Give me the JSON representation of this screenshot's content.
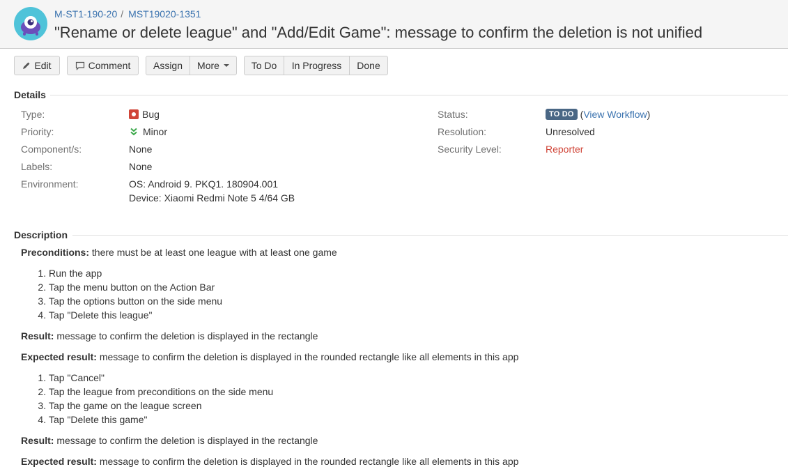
{
  "header": {
    "breadcrumb": [
      {
        "label": "M-ST1-190-20"
      },
      {
        "label": "MST19020-1351"
      }
    ],
    "breadcrumb_separator": "/",
    "summary": "\"Rename or delete league\" and \"Add/Edit Game\": message to confirm the deletion is not unified",
    "avatar_icon": "project-avatar-monster-icon"
  },
  "toolbar": {
    "edit_label": "Edit",
    "comment_label": "Comment",
    "assign_label": "Assign",
    "more_label": "More",
    "todo_label": "To Do",
    "in_progress_label": "In Progress",
    "done_label": "Done"
  },
  "details": {
    "heading": "Details",
    "left": [
      {
        "label": "Type:",
        "value": "Bug",
        "icon": "bug-icon"
      },
      {
        "label": "Priority:",
        "value": "Minor",
        "icon": "priority-minor-icon"
      },
      {
        "label": "Component/s:",
        "value": "None"
      },
      {
        "label": "Labels:",
        "value": "None"
      },
      {
        "label": "Environment:",
        "value": "OS: Android 9. PKQ1. 180904.001",
        "value2": "Device: Xiaomi Redmi Note 5 4/64 GB"
      }
    ],
    "right": {
      "status_label": "Status:",
      "status_value": "TO DO",
      "status_link_open": "(",
      "status_link": "View Workflow",
      "status_link_close": ")",
      "resolution_label": "Resolution:",
      "resolution_value": "Unresolved",
      "security_label": "Security Level:",
      "security_value": "Reporter"
    }
  },
  "description": {
    "heading": "Description",
    "preconditions_label": "Preconditions:",
    "preconditions_text": " there must be at least one league with at least one game",
    "steps_1": [
      "Run the app",
      "Tap the menu button on the Action Bar",
      "Tap the options button on the side menu",
      "Tap \"Delete this league\""
    ],
    "result_label": "Result:",
    "result_text": " message to confirm the deletion is displayed in the rectangle",
    "expected_label": "Expected result:",
    "expected_text": " message to confirm the deletion is displayed in the rounded rectangle like all elements in this app",
    "steps_2": [
      "Tap \"Cancel\"",
      "Tap the league from preconditions on the side menu",
      "Tap the game on the league screen",
      "Tap \"Delete this game\""
    ],
    "result2_label": "Result:",
    "result2_text": " message to confirm the deletion is displayed in the rectangle",
    "expected2_label": "Expected result:",
    "expected2_text": " message to confirm the deletion is displayed in the rounded rectangle like all elements in this app"
  },
  "colors": {
    "link": "#3b73af",
    "status_lozenge": "#4a6785",
    "bug": "#d04437",
    "priority_minor": "#3aa84a",
    "avatar_teal": "#4fc3d9",
    "avatar_purple": "#6b4fbb"
  }
}
